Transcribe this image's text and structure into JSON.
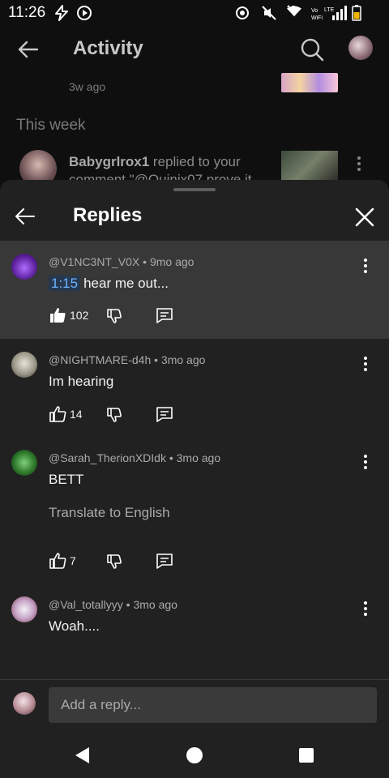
{
  "status_bar": {
    "time": "11:26"
  },
  "activity": {
    "title": "Activity",
    "item1_time": "3w ago",
    "section_label": "This week",
    "item2_user": "Babygrlrox1",
    "item2_text": " replied to your comment \"@Quinix07 prove it"
  },
  "sheet": {
    "title": "Replies",
    "comments": [
      {
        "handle": "@V1NC3NT_V0X",
        "age": "9mo ago",
        "timestamp": "1:15",
        "text": "hear me out...",
        "likes": "102",
        "liked": true
      },
      {
        "handle": "@NIGHTMARE-d4h",
        "age": "3mo ago",
        "text": "Im hearing",
        "likes": "14",
        "liked": false
      },
      {
        "handle": "@Sarah_TherionXDIdk",
        "age": "3mo ago",
        "text": "BETT",
        "translate": "Translate to English",
        "likes": "7",
        "liked": false
      },
      {
        "handle": "@Val_totallyyy",
        "age": "3mo ago",
        "text": "Woah....",
        "liked": false
      }
    ]
  },
  "reply_bar": {
    "placeholder": "Add a reply..."
  },
  "colors": {
    "highlight_bg": "#383838",
    "sheet_bg": "#212121",
    "timestamp_link": "#6fb4ff"
  }
}
